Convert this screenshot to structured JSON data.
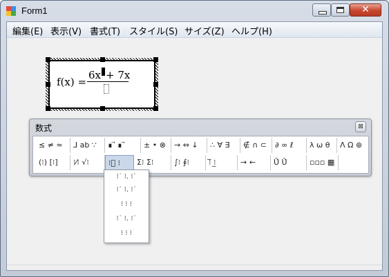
{
  "window": {
    "title": "Form1",
    "close_glyph": "✕"
  },
  "menu": [
    "編集(E)",
    "表示(V)",
    "書式(T)",
    "スタイル(S)",
    "サイズ(Z)",
    "ヘルプ(H)"
  ],
  "formula": {
    "lhs": "f(x) =",
    "numerator_left": "6x",
    "numerator_right": "+ 7x"
  },
  "palette": {
    "title": "数式",
    "close_glyph": "⊠",
    "row1": [
      "≤ ≠ ≈",
      "⅃ ab ∵",
      "∎ ⃗ ∎ ⃗",
      "± • ⊗",
      "→ ⇔ ↓",
      "∴ ∀ ∃",
      "∉ ∩ ⊂",
      "∂ ∞ ℓ",
      "λ ω θ",
      "Λ Ω ⊛"
    ],
    "row2": [
      "(⁝) [⁝]",
      "⁝⁄⁝ √⁝",
      "⁝⃞ ⁝",
      "Σ⁝ Σ⁝",
      "∫⁝ ∮⁝",
      "⁝̅ ⁝̲",
      "→ ←",
      "Ū̇ Ǔ̇",
      "▫▫▫ ▦"
    ]
  },
  "dropdown": [
    "⁝˙ ⁝. ⁝˙",
    "⁝˙ ⁝. ⁝˙",
    "⁝ ⁝ ⁝",
    "⁝˙ ⁝. ⁝˙",
    "⁝ ⁝ ⁝"
  ]
}
